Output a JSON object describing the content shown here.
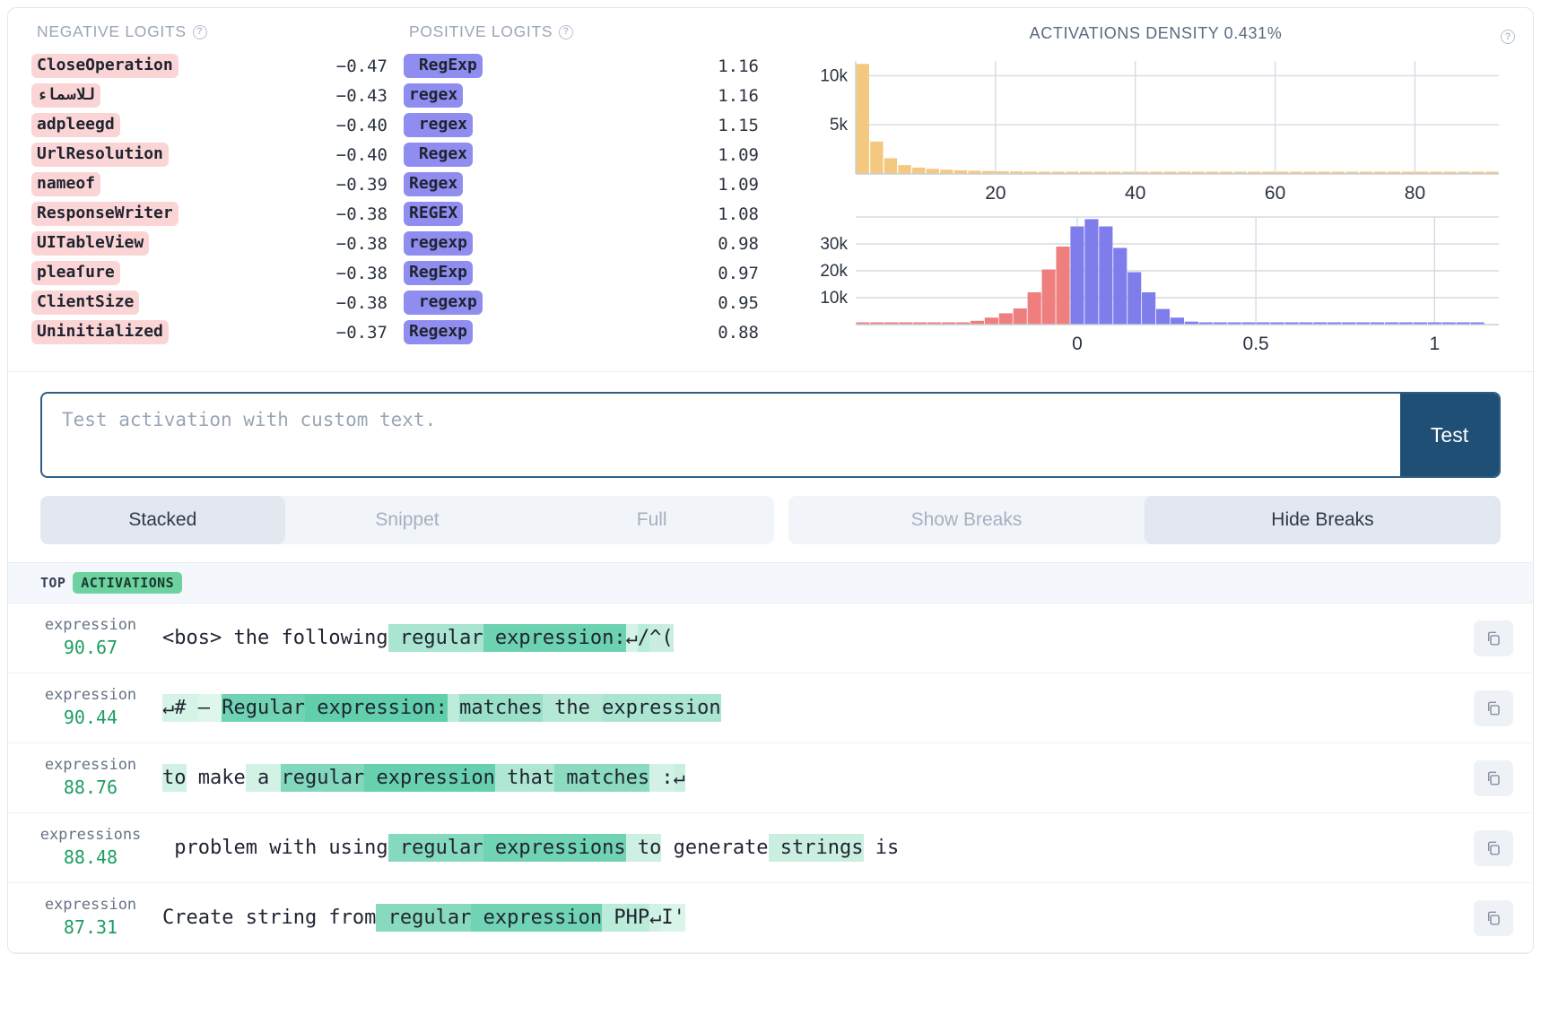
{
  "negative_logits": {
    "title": "NEGATIVE LOGITS",
    "help_icon": "question-circle-icon",
    "rows": [
      {
        "token": "CloseOperation",
        "value": "−0.47"
      },
      {
        "token": "للاسماء",
        "value": "−0.43"
      },
      {
        "token": "adpleegd",
        "value": "−0.40"
      },
      {
        "token": "UrlResolution",
        "value": "−0.40"
      },
      {
        "token": "nameof",
        "value": "−0.39"
      },
      {
        "token": "ResponseWriter",
        "value": "−0.38"
      },
      {
        "token": "UITableView",
        "value": "−0.38"
      },
      {
        "token": "pleaſure",
        "value": "−0.38"
      },
      {
        "token": "ClientSize",
        "value": "−0.38"
      },
      {
        "token": "Uninitialized",
        "value": "−0.37"
      }
    ]
  },
  "positive_logits": {
    "title": "POSITIVE LOGITS",
    "help_icon": "question-circle-icon",
    "rows": [
      {
        "token": " RegExp",
        "value": "1.16"
      },
      {
        "token": "regex",
        "value": "1.16"
      },
      {
        "token": " regex",
        "value": "1.15"
      },
      {
        "token": " Regex",
        "value": "1.09"
      },
      {
        "token": "Regex",
        "value": "1.09"
      },
      {
        "token": "REGEX",
        "value": "1.08"
      },
      {
        "token": "regexp",
        "value": "0.98"
      },
      {
        "token": "RegExp",
        "value": "0.97"
      },
      {
        "token": " regexp",
        "value": "0.95"
      },
      {
        "token": "Regexp",
        "value": "0.88"
      }
    ]
  },
  "charts": {
    "title": "ACTIVATIONS DENSITY 0.431%",
    "help_icon": "question-circle-icon"
  },
  "chart_data": [
    {
      "type": "bar",
      "title": "ACTIVATIONS DENSITY 0.431%",
      "name": "activations-histogram",
      "xlabel": "",
      "ylabel": "",
      "xlim": [
        0,
        92
      ],
      "ylim": [
        0,
        11500
      ],
      "xticks": [
        20,
        40,
        60,
        80
      ],
      "yticks": [
        5000,
        10000
      ],
      "ytick_labels": [
        "5k",
        "10k"
      ],
      "bar_color": "#f5c87f",
      "grid": true,
      "x": [
        1,
        3,
        5,
        7,
        9,
        11,
        13,
        15,
        17,
        19,
        21,
        23,
        25,
        27,
        29,
        31,
        33,
        35,
        37,
        39,
        41,
        43,
        45,
        47,
        49,
        51,
        53,
        55,
        57,
        59,
        61,
        63,
        65,
        67,
        69,
        71,
        73,
        75,
        77,
        79,
        81,
        83,
        85,
        87,
        89,
        91
      ],
      "values": [
        11200,
        3300,
        1600,
        900,
        650,
        520,
        430,
        370,
        330,
        300,
        280,
        260,
        240,
        220,
        200,
        190,
        180,
        170,
        160,
        150,
        145,
        140,
        135,
        130,
        125,
        120,
        115,
        110,
        105,
        100,
        98,
        95,
        92,
        90,
        88,
        85,
        82,
        80,
        78,
        76,
        74,
        72,
        70,
        68,
        66,
        64
      ]
    },
    {
      "type": "bar",
      "name": "logits-histogram",
      "title": "",
      "xlabel": "",
      "ylabel": "",
      "xlim": [
        -0.62,
        1.18
      ],
      "ylim": [
        0,
        40000
      ],
      "xticks": [
        0,
        0.5,
        1
      ],
      "xtick_labels": [
        "0",
        "0.5",
        "1"
      ],
      "yticks": [
        10000,
        20000,
        30000
      ],
      "ytick_labels": [
        "10k",
        "20k",
        "30k"
      ],
      "neg_color": "#ef7f7f",
      "pos_color": "#7f7cec",
      "grid": true,
      "bins": [
        {
          "x": -0.6,
          "v": 320,
          "s": "neg"
        },
        {
          "x": -0.56,
          "v": 330,
          "s": "neg"
        },
        {
          "x": -0.52,
          "v": 340,
          "s": "neg"
        },
        {
          "x": -0.48,
          "v": 350,
          "s": "neg"
        },
        {
          "x": -0.44,
          "v": 360,
          "s": "neg"
        },
        {
          "x": -0.4,
          "v": 380,
          "s": "neg"
        },
        {
          "x": -0.36,
          "v": 420,
          "s": "neg"
        },
        {
          "x": -0.32,
          "v": 600,
          "s": "neg"
        },
        {
          "x": -0.28,
          "v": 1400,
          "s": "neg"
        },
        {
          "x": -0.24,
          "v": 2600,
          "s": "neg"
        },
        {
          "x": -0.2,
          "v": 4200,
          "s": "neg"
        },
        {
          "x": -0.16,
          "v": 6000,
          "s": "neg"
        },
        {
          "x": -0.12,
          "v": 12000,
          "s": "neg"
        },
        {
          "x": -0.08,
          "v": 20500,
          "s": "neg"
        },
        {
          "x": -0.04,
          "v": 29000,
          "s": "neg"
        },
        {
          "x": 0.0,
          "v": 36500,
          "s": "pos"
        },
        {
          "x": 0.04,
          "v": 39200,
          "s": "pos"
        },
        {
          "x": 0.08,
          "v": 36500,
          "s": "pos"
        },
        {
          "x": 0.12,
          "v": 28500,
          "s": "pos"
        },
        {
          "x": 0.16,
          "v": 19500,
          "s": "pos"
        },
        {
          "x": 0.2,
          "v": 12000,
          "s": "pos"
        },
        {
          "x": 0.24,
          "v": 5800,
          "s": "pos"
        },
        {
          "x": 0.28,
          "v": 2600,
          "s": "pos"
        },
        {
          "x": 0.32,
          "v": 1100,
          "s": "pos"
        },
        {
          "x": 0.36,
          "v": 500,
          "s": "pos"
        },
        {
          "x": 0.4,
          "v": 380,
          "s": "pos"
        },
        {
          "x": 0.44,
          "v": 340,
          "s": "pos"
        },
        {
          "x": 0.48,
          "v": 320,
          "s": "pos"
        },
        {
          "x": 0.52,
          "v": 310,
          "s": "pos"
        },
        {
          "x": 0.56,
          "v": 300,
          "s": "pos"
        },
        {
          "x": 0.6,
          "v": 295,
          "s": "pos"
        },
        {
          "x": 0.64,
          "v": 290,
          "s": "pos"
        },
        {
          "x": 0.68,
          "v": 285,
          "s": "pos"
        },
        {
          "x": 0.72,
          "v": 280,
          "s": "pos"
        },
        {
          "x": 0.76,
          "v": 275,
          "s": "pos"
        },
        {
          "x": 0.8,
          "v": 270,
          "s": "pos"
        },
        {
          "x": 0.84,
          "v": 265,
          "s": "pos"
        },
        {
          "x": 0.88,
          "v": 260,
          "s": "pos"
        },
        {
          "x": 0.92,
          "v": 255,
          "s": "pos"
        },
        {
          "x": 0.96,
          "v": 250,
          "s": "pos"
        },
        {
          "x": 1.0,
          "v": 245,
          "s": "pos"
        },
        {
          "x": 1.04,
          "v": 240,
          "s": "pos"
        },
        {
          "x": 1.08,
          "v": 235,
          "s": "pos"
        },
        {
          "x": 1.12,
          "v": 230,
          "s": "pos"
        }
      ]
    }
  ],
  "test": {
    "placeholder": "Test activation with custom text.",
    "value": "",
    "button_label": "Test"
  },
  "view_toggle": {
    "options": [
      "Stacked",
      "Snippet",
      "Full"
    ],
    "selected": "Stacked"
  },
  "breaks_toggle": {
    "options": [
      "Show Breaks",
      "Hide Breaks"
    ],
    "selected": "Hide Breaks"
  },
  "activations_header": {
    "label": "TOP",
    "badge": "ACTIVATIONS"
  },
  "activations": [
    {
      "token": "expression",
      "value": "90.67",
      "copy_icon": "copy-icon",
      "segments": [
        {
          "t": "<bos> the following",
          "a": 0
        },
        {
          "t": " regular",
          "a": 0.42
        },
        {
          "t": " expression:",
          "a": 0.82
        },
        {
          "t": "↵",
          "a": 0.12
        },
        {
          "t": "/",
          "a": 0.3
        },
        {
          "t": "^(",
          "a": 0.22
        }
      ]
    },
    {
      "token": "expression",
      "value": "90.44",
      "copy_icon": "copy-icon",
      "segments": [
        {
          "t": "↵# ",
          "a": 0.12
        },
        {
          "t": "– ",
          "a": 0.06
        },
        {
          "t": "Regular",
          "a": 0.8
        },
        {
          "t": " expression:",
          "a": 0.9
        },
        {
          "t": " ",
          "a": 0.28
        },
        {
          "t": "matches",
          "a": 0.52
        },
        {
          "t": " the ",
          "a": 0.34
        },
        {
          "t": "expression",
          "a": 0.42
        }
      ]
    },
    {
      "token": "expression",
      "value": "88.76",
      "copy_icon": "copy-icon",
      "segments": [
        {
          "t": "to",
          "a": 0.16
        },
        {
          "t": " make",
          "a": 0
        },
        {
          "t": " a ",
          "a": 0.14
        },
        {
          "t": "regular",
          "a": 0.68
        },
        {
          "t": " expression",
          "a": 0.86
        },
        {
          "t": " that",
          "a": 0.38
        },
        {
          "t": " matches",
          "a": 0.62
        },
        {
          "t": " :",
          "a": 0.14
        },
        {
          "t": "↵",
          "a": 0.2
        }
      ]
    },
    {
      "token": "expressions",
      "value": "88.48",
      "copy_icon": "copy-icon",
      "segments": [
        {
          "t": " problem with using",
          "a": 0
        },
        {
          "t": " regular",
          "a": 0.66
        },
        {
          "t": " expressions",
          "a": 0.8
        },
        {
          "t": " to",
          "a": 0.18
        },
        {
          "t": " generate",
          "a": 0
        },
        {
          "t": " strings",
          "a": 0.2
        },
        {
          "t": " is",
          "a": 0
        }
      ]
    },
    {
      "token": "expression",
      "value": "87.31",
      "copy_icon": "copy-icon",
      "segments": [
        {
          "t": "Create string from",
          "a": 0
        },
        {
          "t": " regular",
          "a": 0.64
        },
        {
          "t": " expression",
          "a": 0.8
        },
        {
          "t": " PHP",
          "a": 0.3
        },
        {
          "t": "↵",
          "a": 0.16
        },
        {
          "t": "I'",
          "a": 0.1
        }
      ]
    }
  ]
}
